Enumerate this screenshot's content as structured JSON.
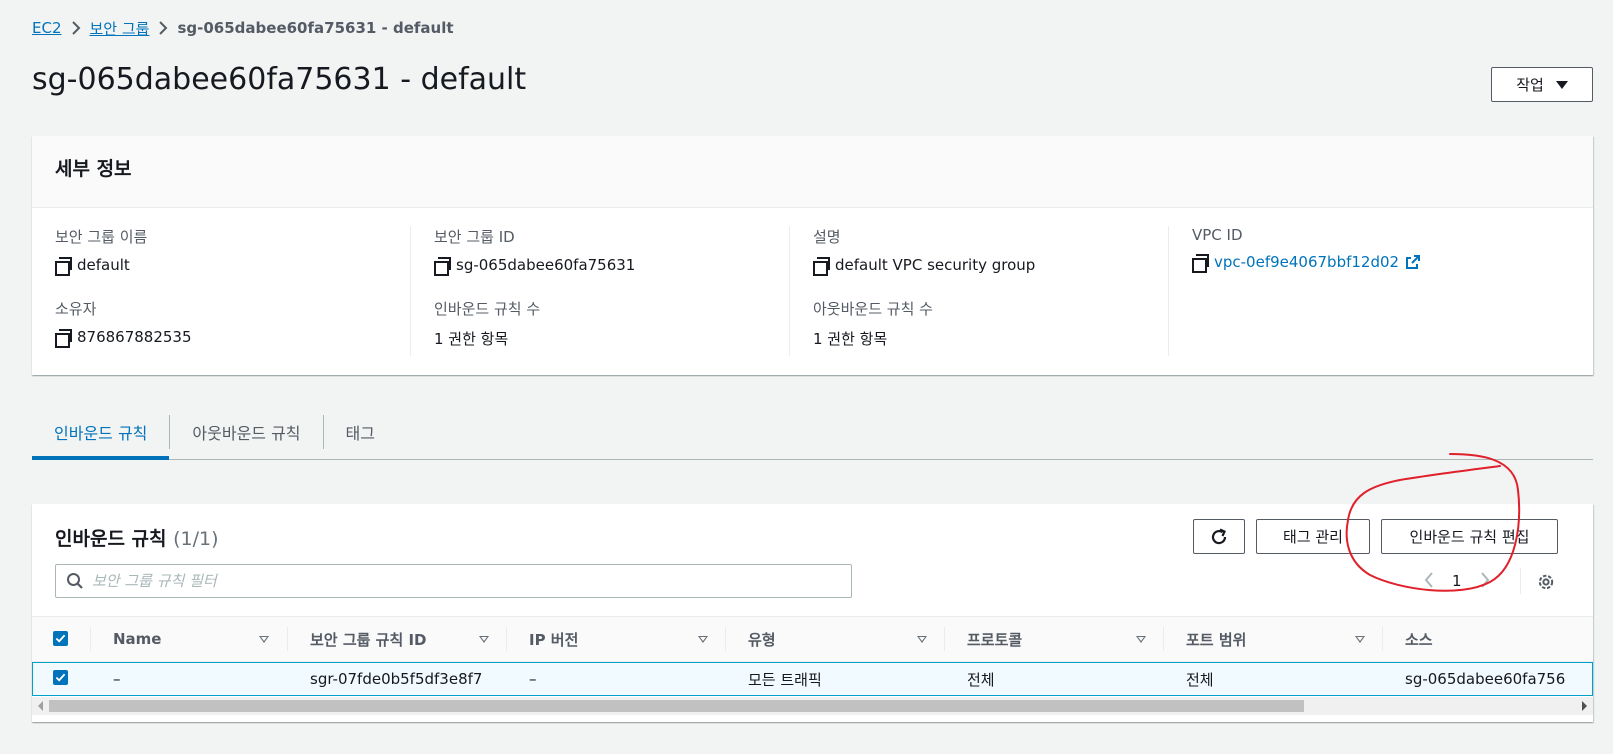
{
  "breadcrumb": {
    "items": [
      "EC2",
      "보안 그룹"
    ],
    "current": "sg-065dabee60fa75631 - default"
  },
  "header": {
    "title": "sg-065dabee60fa75631 - default",
    "actions_label": "작업"
  },
  "details": {
    "title": "세부 정보",
    "fields": {
      "sg_name": {
        "label": "보안 그룹 이름",
        "value": "default"
      },
      "sg_id": {
        "label": "보안 그룹 ID",
        "value": "sg-065dabee60fa75631"
      },
      "description": {
        "label": "설명",
        "value": "default VPC security group"
      },
      "vpc_id": {
        "label": "VPC ID",
        "value": "vpc-0ef9e4067bbf12d02"
      },
      "owner": {
        "label": "소유자",
        "value": "876867882535"
      },
      "inbound_count": {
        "label": "인바운드 규칙 수",
        "value": "1 권한 항목"
      },
      "outbound_count": {
        "label": "아웃바운드 규칙 수",
        "value": "1 권한 항목"
      }
    }
  },
  "tabs": [
    {
      "label": "인바운드 규칙",
      "active": true
    },
    {
      "label": "아웃바운드 규칙",
      "active": false
    },
    {
      "label": "태그",
      "active": false
    }
  ],
  "rules_panel": {
    "title": "인바운드 규칙",
    "count": "(1/1)",
    "manage_tags_label": "태그 관리",
    "edit_rules_label": "인바운드 규칙 편집",
    "filter_placeholder": "보안 그룹 규칙 필터",
    "page": "1",
    "columns": [
      "Name",
      "보안 그룹 규칙 ID",
      "IP 버전",
      "유형",
      "프로토콜",
      "포트 범위",
      "소스"
    ],
    "rows": [
      [
        "–",
        "sgr-07fde0b5f5df3e8f7",
        "–",
        "모든 트래픽",
        "전체",
        "전체",
        "sg-065dabee60fa756"
      ]
    ]
  },
  "colors": {
    "link": "#0073bb",
    "annotation": "#e0202a"
  }
}
